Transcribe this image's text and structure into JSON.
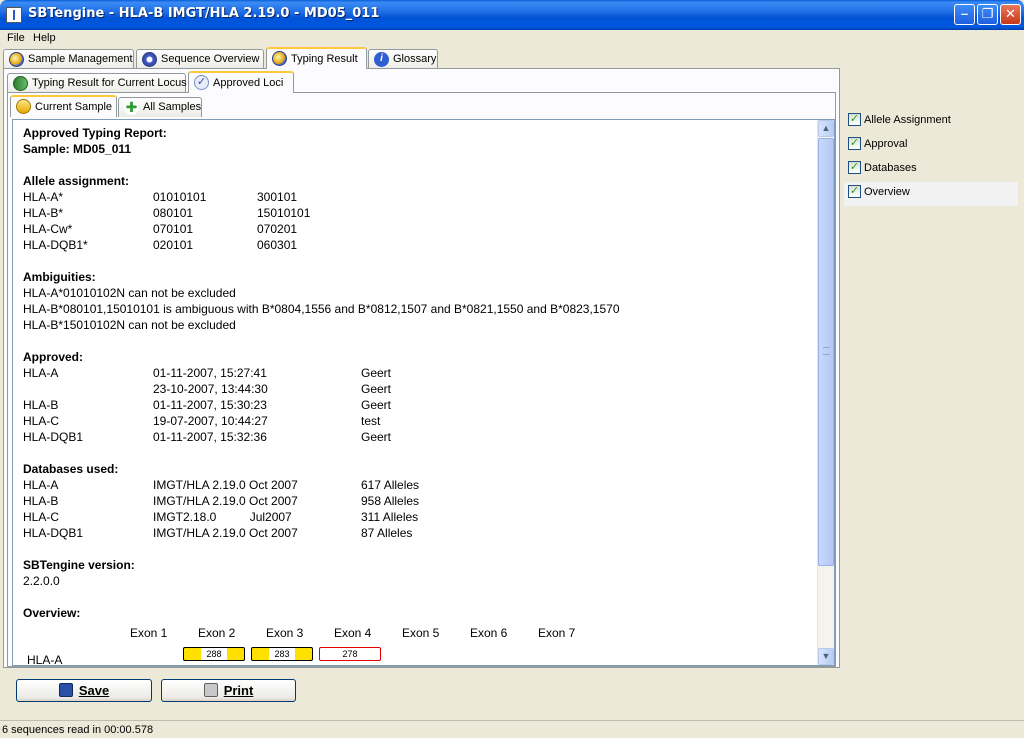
{
  "window": {
    "title": "SBTengine - HLA-B IMGT/HLA 2.19.0 - MD05_011"
  },
  "menu": [
    "File",
    "Help"
  ],
  "main_tabs": [
    {
      "label": "Sample Management",
      "icon": "globe-icon",
      "active": false
    },
    {
      "label": "Sequence Overview",
      "icon": "gear-icon",
      "active": false
    },
    {
      "label": "Typing Result",
      "icon": "globe-icon",
      "active": true
    },
    {
      "label": "Glossary",
      "icon": "info-icon",
      "active": false
    }
  ],
  "sub_tabs": [
    {
      "label": "Typing Result for Current Locus",
      "icon": "book-icon",
      "active": false
    },
    {
      "label": "Approved Loci",
      "icon": "checklist-icon",
      "active": true
    }
  ],
  "sample_tabs": [
    {
      "label": "Current Sample",
      "icon": "folder-icon",
      "active": true
    },
    {
      "label": "All Samples",
      "icon": "plus-icon",
      "active": false
    }
  ],
  "report": {
    "title": "Approved Typing Report:",
    "sample": "Sample: MD05_011",
    "allele_heading": "Allele assignment:",
    "alleles": [
      {
        "locus": "HLA-A*",
        "a1": "01010101",
        "a2": "300101"
      },
      {
        "locus": "HLA-B*",
        "a1": "080101",
        "a2": "15010101"
      },
      {
        "locus": "HLA-Cw*",
        "a1": "070101",
        "a2": "070201"
      },
      {
        "locus": "HLA-DQB1*",
        "a1": "020101",
        "a2": "060301"
      }
    ],
    "ambiguities_heading": "Ambiguities:",
    "ambiguities": [
      "HLA-A*01010102N can not be excluded",
      "HLA-B*080101,15010101 is ambiguous with B*0804,1556 and B*0812,1507 and B*0821,1550 and B*0823,1570",
      "HLA-B*15010102N can not be excluded"
    ],
    "approved_heading": "Approved:",
    "approved": [
      {
        "locus": "HLA-A",
        "date": "01-11-2007, 15:27:41",
        "user": "Geert"
      },
      {
        "locus": "",
        "date": "23-10-2007, 13:44:30",
        "user": "Geert"
      },
      {
        "locus": "HLA-B",
        "date": "01-11-2007, 15:30:23",
        "user": "Geert"
      },
      {
        "locus": "HLA-C",
        "date": "19-07-2007, 10:44:27",
        "user": "test"
      },
      {
        "locus": "HLA-DQB1",
        "date": "01-11-2007, 15:32:36",
        "user": "Geert"
      }
    ],
    "databases_heading": "Databases used:",
    "databases": [
      {
        "locus": "HLA-A",
        "db": "IMGT/HLA 2.19.0 Oct 2007",
        "count": "617 Alleles"
      },
      {
        "locus": "HLA-B",
        "db": "IMGT/HLA 2.19.0 Oct 2007",
        "count": "958 Alleles"
      },
      {
        "locus": "HLA-C",
        "db": "IMGT2.18.0          Jul2007",
        "count": "311 Alleles"
      },
      {
        "locus": "HLA-DQB1",
        "db": "IMGT/HLA 2.19.0 Oct 2007",
        "count": "87 Alleles"
      }
    ],
    "version_heading": "SBTengine version:",
    "version": "2.2.0.0",
    "overview_heading": "Overview:",
    "exons": [
      "Exon 1",
      "Exon 2",
      "Exon 3",
      "Exon 4",
      "Exon 5",
      "Exon 6",
      "Exon 7"
    ],
    "overview_rows": [
      {
        "locus": "HLA-A",
        "exon2": "288",
        "exon3": "283",
        "exon4": "278"
      }
    ]
  },
  "options": [
    {
      "label": "Allele Assignment",
      "checked": true
    },
    {
      "label": "Approval",
      "checked": true
    },
    {
      "label": "Databases",
      "checked": true
    },
    {
      "label": "Overview",
      "checked": true
    }
  ],
  "buttons": {
    "save": "Save",
    "print": "Print"
  },
  "status": "6 sequences read in 00:00.578",
  "colors": {
    "title_bar": "#0053d6",
    "active_tab_accent": "#ffc83c",
    "exon_yellow": "#ffe000",
    "exon_red": "#e00000"
  }
}
